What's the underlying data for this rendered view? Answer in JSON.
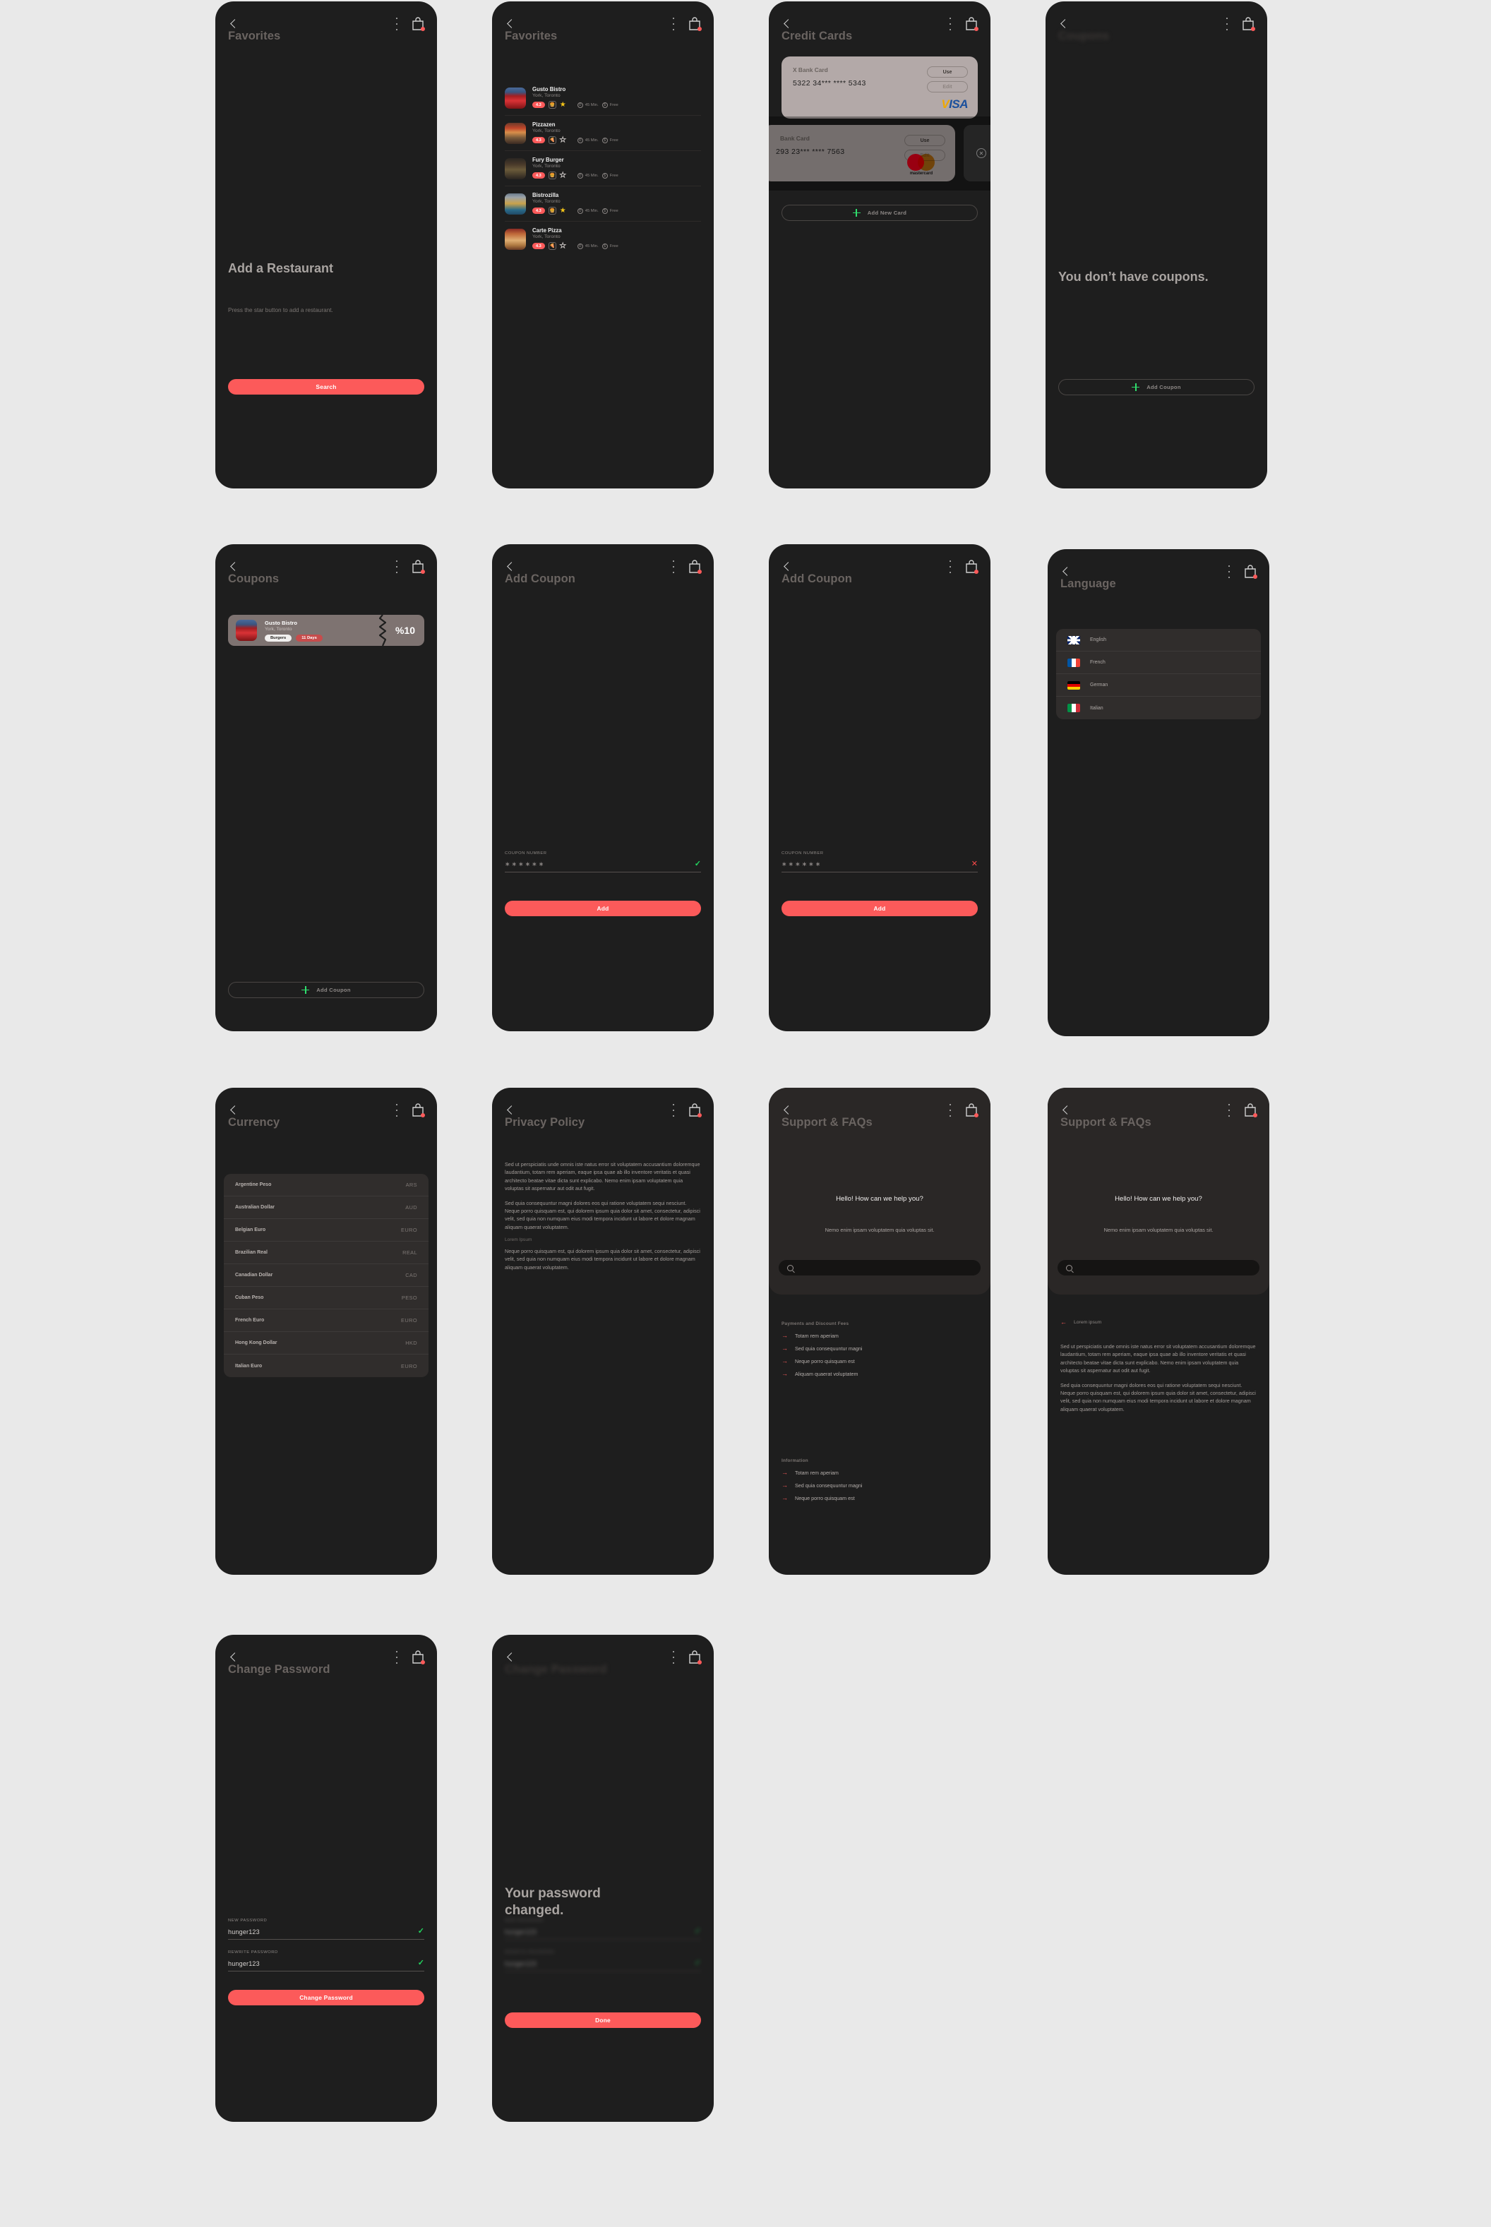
{
  "meta": {
    "accent_red": "#fc5a5a",
    "accent_green": "#2fdd6d",
    "board_bg": "#e9e9e9",
    "phone_bg": "#1e1e1e"
  },
  "common": {
    "back_icon": "chevron-left-icon",
    "menu_icon": "kebab-menu-icon",
    "bag_icon": "shopping-bag-icon"
  },
  "screens": {
    "favorites_empty": {
      "title": "Favorites",
      "hero": "Add a Restaurant",
      "hero_sub": "Press the star button to add a restaurant.",
      "button": "Search"
    },
    "favorites_list": {
      "title": "Favorites",
      "restaurants": [
        {
          "name": "Gusto Bistro",
          "location": "York, Toronto",
          "rating": "4.3",
          "category_icon": "burger-icon",
          "starred": true,
          "time": "45 Min.",
          "fee": "Free"
        },
        {
          "name": "Pizzazen",
          "location": "York, Toronto",
          "rating": "4.3",
          "category_icon": "pizza-icon",
          "starred": false,
          "time": "45 Min.",
          "fee": "Free"
        },
        {
          "name": "Fury Burger",
          "location": "York, Toronto",
          "rating": "4.3",
          "category_icon": "burger-icon",
          "starred": false,
          "time": "45 Min.",
          "fee": "Free"
        },
        {
          "name": "Bistrozilla",
          "location": "York, Toronto",
          "rating": "4.3",
          "category_icon": "burger-icon",
          "starred": true,
          "time": "45 Min.",
          "fee": "Free"
        },
        {
          "name": "Carte Pizza",
          "location": "York, Toronto",
          "rating": "4.3",
          "category_icon": "pizza-icon",
          "starred": false,
          "time": "45 Min.",
          "fee": "Free"
        }
      ]
    },
    "credit_cards": {
      "title": "Credit Cards",
      "cards": [
        {
          "name": "X Bank Card",
          "number": "5322 34*** **** 5343",
          "use": "Use",
          "edit": "Edit",
          "brand": "VISA"
        },
        {
          "name": "Bank Card",
          "number": "293 23*** **** 7563",
          "use": "Use",
          "edit": "Edit",
          "brand": "mastercard"
        }
      ],
      "add_button": "Add New Card"
    },
    "coupons_empty": {
      "title": "Coupons",
      "hero": "You don’t have coupons.",
      "add_button": "Add Coupon"
    },
    "coupons_list": {
      "title": "Coupons",
      "coupon": {
        "name": "Gusto Bistro",
        "location": "York, Toronto",
        "tag_category": "Burgers",
        "tag_expiry": "11 Days",
        "percent": "%10"
      },
      "add_button": "Add Coupon"
    },
    "add_coupon_valid": {
      "title": "Add Coupon",
      "field_label": "COUPON NUMBER",
      "field_value": "∗∗∗∗∗∗",
      "status_icon": "check-icon",
      "button": "Add"
    },
    "add_coupon_invalid": {
      "title": "Add Coupon",
      "field_label": "COUPON NUMBER",
      "field_value": "∗∗∗∗∗∗",
      "status_icon": "cross-icon",
      "button": "Add"
    },
    "language": {
      "title": "Language",
      "options": [
        {
          "label": "English",
          "flag": "uk-flag-icon"
        },
        {
          "label": "French",
          "flag": "france-flag-icon"
        },
        {
          "label": "German",
          "flag": "germany-flag-icon"
        },
        {
          "label": "Italian",
          "flag": "italy-flag-icon"
        }
      ]
    },
    "currency": {
      "title": "Currency",
      "rows": [
        {
          "name": "Argentine Peso",
          "code": "ARS"
        },
        {
          "name": "Australian Dollar",
          "code": "AUD"
        },
        {
          "name": "Belgian Euro",
          "code": "EURO"
        },
        {
          "name": "Brazilian Real",
          "code": "REAL"
        },
        {
          "name": "Canadian Dollar",
          "code": "CAD"
        },
        {
          "name": "Cuban Peso",
          "code": "PESO"
        },
        {
          "name": "French Euro",
          "code": "EURO"
        },
        {
          "name": "Hong Kong Dollar",
          "code": "HKD"
        },
        {
          "name": "Italian Euro",
          "code": "EURO"
        }
      ]
    },
    "privacy_policy": {
      "title": "Privacy Policy",
      "p1": "Sed ut perspiciatis unde omnis iste natus error sit voluptatem accusantium doloremque laudantium, totam rem aperiam, eaque ipsa quae ab illo inventore veritatis et quasi architecto beatae vitae dicta sunt explicabo. Nemo enim ipsam voluptatem quia voluptas sit aspernatur aut odit aut fugit.",
      "p2": "Sed quia consequuntur magni dolores eos qui ratione voluptatem sequi nesciunt. Neque porro quisquam est, qui dolorem ipsum quia dolor sit amet, consectetur, adipisci velit, sed quia non numquam eius modi tempora incidunt ut labore et dolore magnam aliquam quaerat voluptatem.",
      "subheading": "Lorem Ipsum",
      "p3": "Neque porro quisquam est, qui dolorem ipsum quia dolor sit amet, consectetur, adipisci velit, sed quia non numquam eius modi tempora incidunt ut labore et dolore magnam aliquam quaerat voluptatem."
    },
    "support_list": {
      "title": "Support & FAQs",
      "greeting": "Hello! How can we help you?",
      "subtitle": "Nemo enim ipsam voluptatem quia voluptas sit.",
      "search_placeholder": "",
      "sections": [
        {
          "title": "Payments and Discount Fees",
          "items": [
            "Totam rem aperiam",
            "Sed quia consequuntur magni",
            "Neque porro quisquam est",
            "Aliquam quaerat voluptatem"
          ]
        },
        {
          "title": "Information",
          "items": [
            "Totam rem aperiam",
            "Sed quia consequuntur magni",
            "Neque porro quisquam est"
          ]
        }
      ]
    },
    "support_detail": {
      "title": "Support & FAQs",
      "greeting": "Hello! How can we help you?",
      "subtitle": "Nemo enim ipsam voluptatem quia voluptas sit.",
      "back_label": "Lorem ipsum",
      "p1": "Sed ut perspiciatis unde omnis iste natus error sit voluptatem accusantium doloremque laudantium, totam rem aperiam, eaque ipsa quae ab illo inventore veritatis et quasi architecto beatae vitae dicta sunt explicabo. Nemo enim ipsam voluptatem quia voluptas sit aspernatur aut odit aut fugit.",
      "p2": "Sed quia consequuntur magni dolores eos qui ratione voluptatem sequi nesciunt. Neque porro quisquam est, qui dolorem ipsum quia dolor sit amet, consectetur, adipisci velit, sed quia non numquam eius modi tempora incidunt ut labore et dolore magnam aliquam quaerat voluptatem."
    },
    "change_password": {
      "title": "Change Password",
      "new_label": "NEW PASSWORD",
      "new_value": "hunger123",
      "rewrite_label": "REWRITE PASSWORD",
      "rewrite_value": "hunger123",
      "button": "Change Password"
    },
    "password_changed": {
      "title": "Change Password",
      "hero": "Your password changed.",
      "new_label": "NEW PASSWORD",
      "new_value": "hunger123",
      "rewrite_label": "REWRITE PASSWORD",
      "rewrite_value": "hunger123",
      "button": "Done"
    }
  }
}
